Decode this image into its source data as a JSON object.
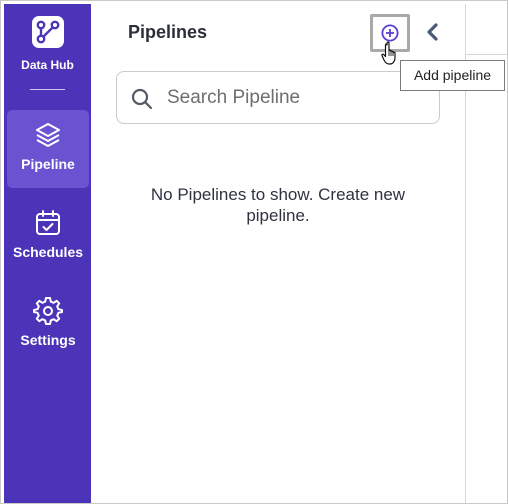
{
  "brand": {
    "label": "Data Hub",
    "icon": "branch-logo-icon"
  },
  "nav": {
    "items": [
      {
        "label": "Pipeline",
        "icon": "layers-icon",
        "active": true
      },
      {
        "label": "Schedules",
        "icon": "calendar-check-icon",
        "active": false
      },
      {
        "label": "Settings",
        "icon": "gear-icon",
        "active": false
      }
    ]
  },
  "panel": {
    "title": "Pipelines",
    "add_icon": "plus-circle-icon",
    "collapse_icon": "chevron-left-icon",
    "tooltip": "Add pipeline"
  },
  "search": {
    "placeholder": "Search Pipeline",
    "value": ""
  },
  "empty_state": {
    "message": "No Pipelines to show. Create new pipeline."
  },
  "colors": {
    "sidebar": "#4c34b8",
    "sidebar_active": "#6a53d0",
    "accent": "#5b3fd1"
  }
}
